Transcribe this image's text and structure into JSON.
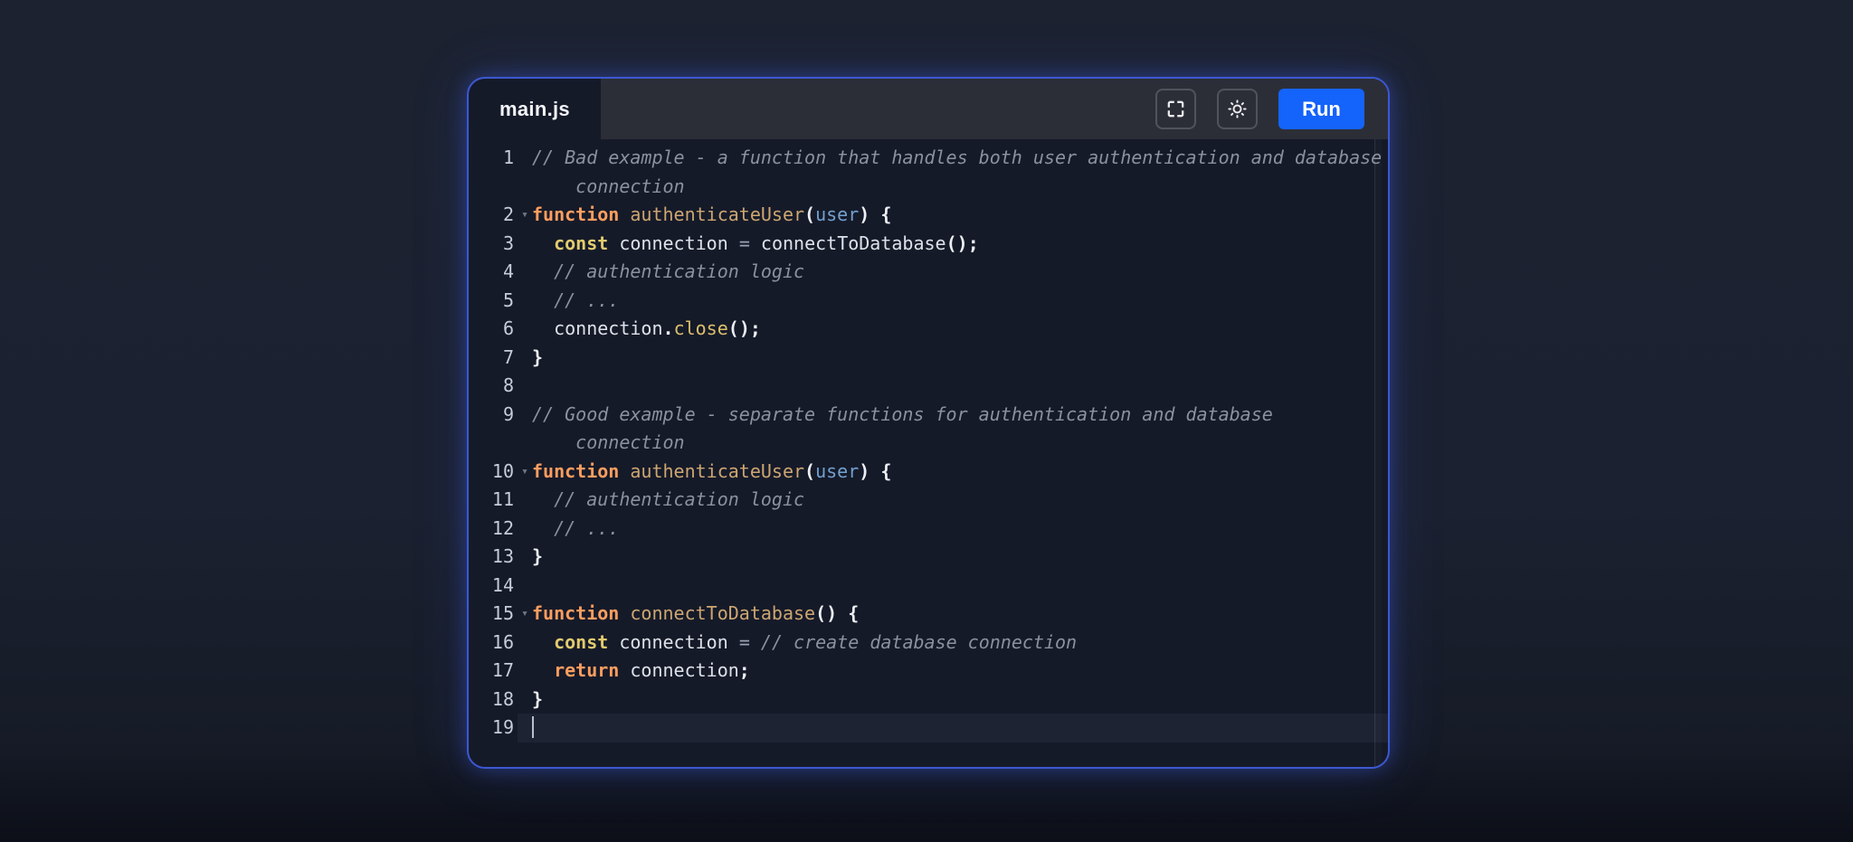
{
  "window": {
    "tab_label": "main.js",
    "toolbar": {
      "fullscreen_icon": "fullscreen-expand-icon",
      "theme_icon": "sun-brightness-icon",
      "run_label": "Run"
    }
  },
  "editor": {
    "language": "javascript",
    "fold_glyph": "▾",
    "active_line": 19,
    "lines": [
      {
        "n": "1",
        "hang": true,
        "tokens": [
          {
            "c": "comment",
            "s": "// Bad example - a function that handles both user authentication and database connection"
          }
        ]
      },
      {
        "n": "2",
        "fold": true,
        "tokens": [
          {
            "c": "kw",
            "s": "function"
          },
          {
            "c": "pl",
            "s": " "
          },
          {
            "c": "fn",
            "s": "authenticateUser"
          },
          {
            "c": "pu",
            "s": "("
          },
          {
            "c": "pm",
            "s": "user"
          },
          {
            "c": "pu",
            "s": ")"
          },
          {
            "c": "pl",
            "s": " "
          },
          {
            "c": "pu",
            "s": "{"
          }
        ]
      },
      {
        "n": "3",
        "tokens": [
          {
            "c": "pl",
            "s": "  "
          },
          {
            "c": "ck",
            "s": "const"
          },
          {
            "c": "pl",
            "s": " connection "
          },
          {
            "c": "op",
            "s": "="
          },
          {
            "c": "pl",
            "s": " connectToDatabase"
          },
          {
            "c": "pu",
            "s": "();"
          }
        ]
      },
      {
        "n": "4",
        "tokens": [
          {
            "c": "pl",
            "s": "  "
          },
          {
            "c": "comment",
            "s": "// authentication logic"
          }
        ]
      },
      {
        "n": "5",
        "tokens": [
          {
            "c": "pl",
            "s": "  "
          },
          {
            "c": "comment",
            "s": "// ..."
          }
        ]
      },
      {
        "n": "6",
        "tokens": [
          {
            "c": "pl",
            "s": "  connection"
          },
          {
            "c": "pu",
            "s": "."
          },
          {
            "c": "mt",
            "s": "close"
          },
          {
            "c": "pu",
            "s": "();"
          }
        ]
      },
      {
        "n": "7",
        "tokens": [
          {
            "c": "pu",
            "s": "}"
          }
        ]
      },
      {
        "n": "8",
        "tokens": []
      },
      {
        "n": "9",
        "hang": true,
        "tokens": [
          {
            "c": "comment",
            "s": "// Good example - separate functions for authentication and database connection"
          }
        ]
      },
      {
        "n": "10",
        "fold": true,
        "tokens": [
          {
            "c": "kw",
            "s": "function"
          },
          {
            "c": "pl",
            "s": " "
          },
          {
            "c": "fn",
            "s": "authenticateUser"
          },
          {
            "c": "pu",
            "s": "("
          },
          {
            "c": "pm",
            "s": "user"
          },
          {
            "c": "pu",
            "s": ")"
          },
          {
            "c": "pl",
            "s": " "
          },
          {
            "c": "pu",
            "s": "{"
          }
        ]
      },
      {
        "n": "11",
        "tokens": [
          {
            "c": "pl",
            "s": "  "
          },
          {
            "c": "comment",
            "s": "// authentication logic"
          }
        ]
      },
      {
        "n": "12",
        "tokens": [
          {
            "c": "pl",
            "s": "  "
          },
          {
            "c": "comment",
            "s": "// ..."
          }
        ]
      },
      {
        "n": "13",
        "tokens": [
          {
            "c": "pu",
            "s": "}"
          }
        ]
      },
      {
        "n": "14",
        "tokens": []
      },
      {
        "n": "15",
        "fold": true,
        "tokens": [
          {
            "c": "kw",
            "s": "function"
          },
          {
            "c": "pl",
            "s": " "
          },
          {
            "c": "fn",
            "s": "connectToDatabase"
          },
          {
            "c": "pu",
            "s": "()"
          },
          {
            "c": "pl",
            "s": " "
          },
          {
            "c": "pu",
            "s": "{"
          }
        ]
      },
      {
        "n": "16",
        "tokens": [
          {
            "c": "pl",
            "s": "  "
          },
          {
            "c": "ck",
            "s": "const"
          },
          {
            "c": "pl",
            "s": " connection "
          },
          {
            "c": "op",
            "s": "="
          },
          {
            "c": "pl",
            "s": " "
          },
          {
            "c": "comment",
            "s": "// create database connection"
          }
        ]
      },
      {
        "n": "17",
        "tokens": [
          {
            "c": "pl",
            "s": "  "
          },
          {
            "c": "kw",
            "s": "return"
          },
          {
            "c": "pl",
            "s": " connection"
          },
          {
            "c": "pu",
            "s": ";"
          }
        ]
      },
      {
        "n": "18",
        "tokens": [
          {
            "c": "pu",
            "s": "}"
          }
        ]
      },
      {
        "n": "19",
        "active": true,
        "cursor": true,
        "tokens": []
      }
    ]
  },
  "colors": {
    "page_bg": "#1b2130",
    "editor_bg": "#151a29",
    "toolbar_bg": "#2c2e37",
    "accent_border": "#3c58d2",
    "run_button": "#1463fa",
    "active_line_bg": "#1d2333",
    "comment": "#8b919f",
    "keyword": "#ff9e5f",
    "const_keyword": "#e2cb6d",
    "function_name": "#cda671",
    "parameter": "#73a1ce",
    "line_number": "#c6ccd8"
  }
}
